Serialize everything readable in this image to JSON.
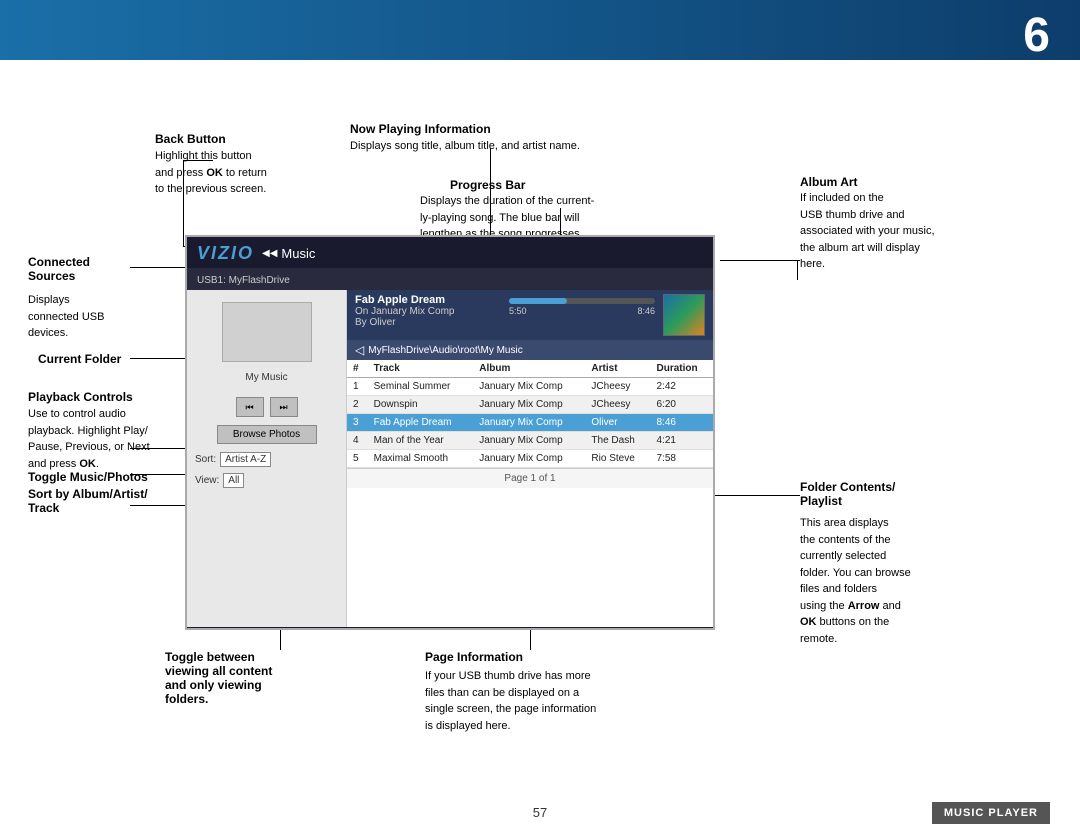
{
  "page": {
    "number": "6",
    "footer_page": "57",
    "music_player_label": "MUSIC PLAYER"
  },
  "annotations": {
    "back_button": {
      "title": "Back Button",
      "desc": "Highlight this button\nand press OK to return\nto the previous screen."
    },
    "now_playing": {
      "title": "Now Playing Information",
      "desc": "Displays song title, album title, and artist name."
    },
    "progress_bar": {
      "title": "Progress Bar",
      "desc": "Displays the duration of the current-\nly-playing song. The blue bar will\nlengthen as the song progresses."
    },
    "album_art": {
      "title": "Album Art",
      "desc": "If included on the\nUSB thumb drive and\nassociated with your music,\nthe album art will display\nhere."
    },
    "connected_sources": {
      "title": "Connected\nSources",
      "desc": "Displays\nconnected USB\ndevices."
    },
    "current_folder": {
      "title": "Current Folder"
    },
    "playback_controls": {
      "title": "Playback Controls",
      "desc": "Use to control audio\nplayback. Highlight Play/\nPause, Previous, or Next\nand press OK."
    },
    "toggle_music_photos": {
      "title": "Toggle Music/Photos"
    },
    "sort_by": {
      "title": "Sort by Album/Artist/\nTrack"
    },
    "toggle_viewing": {
      "title": "Toggle between\nviewing all content\nand only viewing\nfolders."
    },
    "page_information": {
      "title": "Page Information",
      "desc": "If your USB thumb drive has more\nfiles than can be displayed on a\nsingle screen, the page information\nis displayed here."
    },
    "folder_contents": {
      "title": "Folder Contents/\nPlaylist",
      "desc": "This area displays\nthe contents of the\ncurrently selected\nfolder. You can browse\nfiles and folders\nusing the Arrow and\nOK buttons on the\nremote."
    }
  },
  "ui": {
    "vizio_logo": "VIZIO",
    "music_section": "Music",
    "usb_drive": "USB1: MyFlashDrive",
    "folder_name": "My Music",
    "now_playing": {
      "title": "Fab Apple Dream",
      "on": "On  January Mix Comp",
      "by": "By  Oliver"
    },
    "progress": {
      "current": "5:50",
      "total": "8:46"
    },
    "path": "MyFlashDrive\\Audio\\root\\My Music",
    "table": {
      "headers": [
        "#",
        "Track",
        "Album",
        "Artist",
        "Duration"
      ],
      "rows": [
        [
          "1",
          "Seminal Summer",
          "January Mix Comp",
          "JCheesy",
          "2:42"
        ],
        [
          "2",
          "Downspin",
          "January Mix Comp",
          "JCheesy",
          "6:20"
        ],
        [
          "3",
          "Fab Apple Dream",
          "January Mix Comp",
          "Oliver",
          "8:46"
        ],
        [
          "4",
          "Man of the Year",
          "January Mix Comp",
          "The Dash",
          "4:21"
        ],
        [
          "5",
          "Maximal Smooth",
          "January Mix Comp",
          "Rio Steve",
          "7:58"
        ]
      ],
      "selected_row": 2
    },
    "page_info": "Page 1 of 1",
    "browse_photos": "Browse Photos",
    "sort": {
      "label": "Sort:",
      "value": "Artist A-Z"
    },
    "view": {
      "label": "View:",
      "value": "All"
    },
    "controls": {
      "prev": "⏮",
      "next": "⏭"
    }
  }
}
